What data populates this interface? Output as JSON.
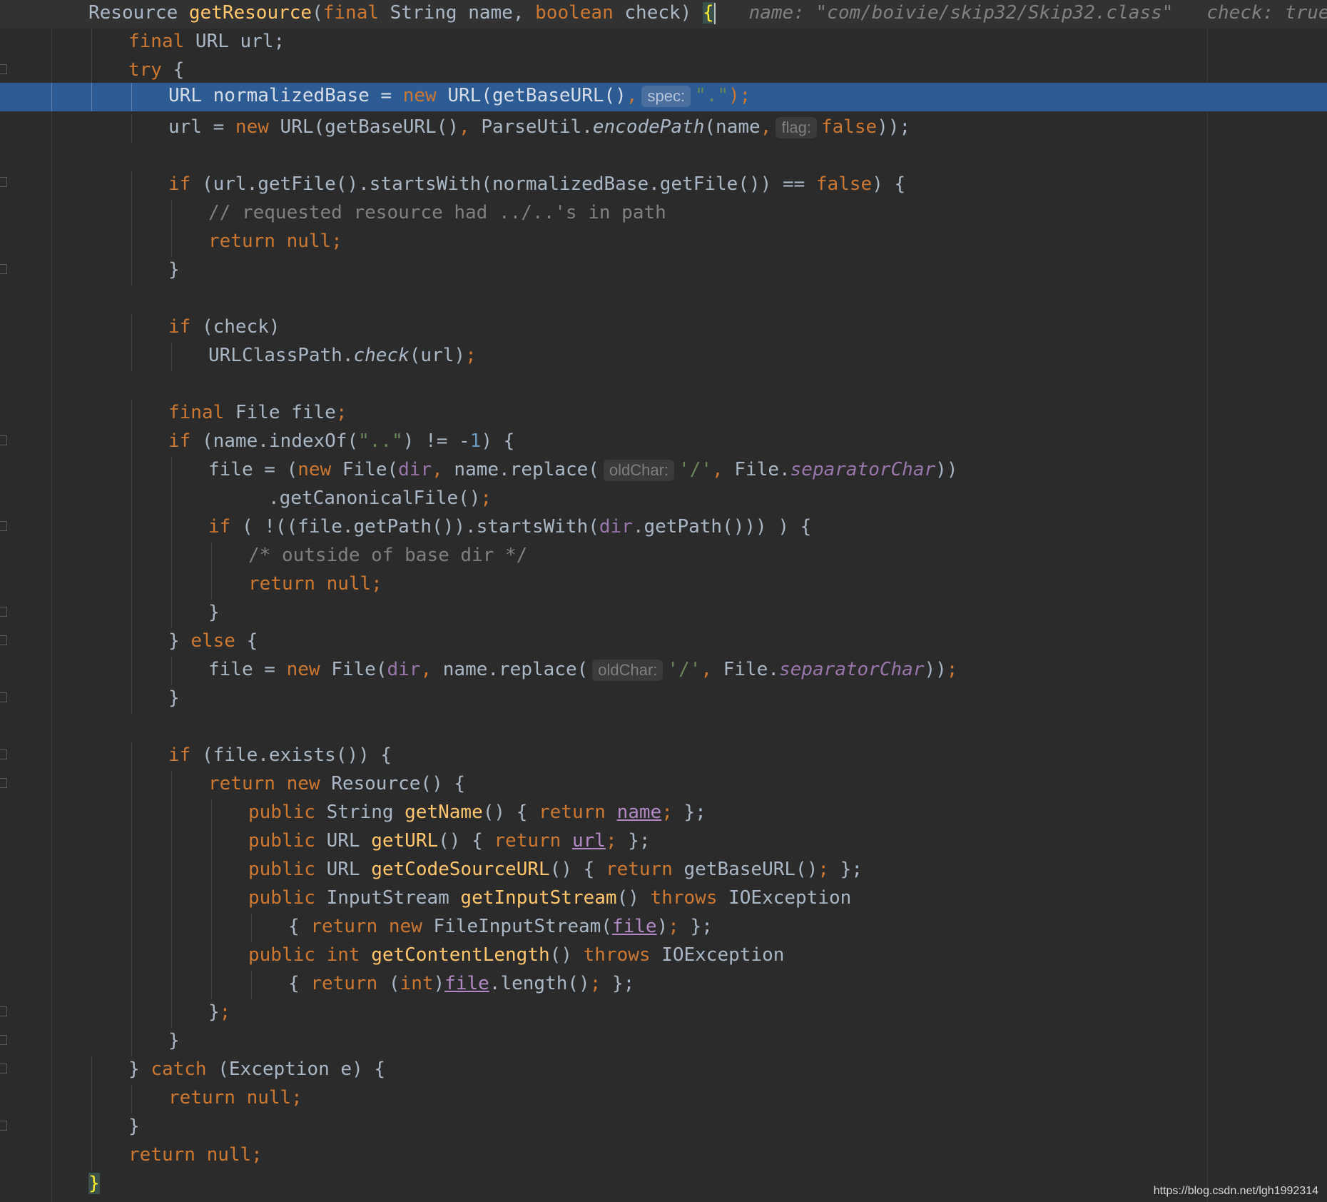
{
  "editor": {
    "theme_colors": {
      "background": "#2b2b2b",
      "keyword": "#cc7832",
      "method": "#ffc66d",
      "string": "#6a8759",
      "number": "#6897bb",
      "comment": "#808080",
      "field": "#9876aa",
      "execution_line": "#2d5b93"
    }
  },
  "lines": {
    "l1": {
      "a": "Resource ",
      "b": "getResource",
      "c": "(",
      "d": "final ",
      "e": "String name, ",
      "f": "boolean ",
      "g": "check) ",
      "h": "{",
      "i": "name: \"com/boivie/skip32/Skip32.class\"   check: true"
    },
    "l2": {
      "a": "final ",
      "b": "URL url;"
    },
    "l3": {
      "a": "try ",
      "b": "{"
    },
    "l4": {
      "a": "URL normalizedBase = ",
      "b": "new ",
      "c": "URL(getBaseURL()",
      "d": ",",
      "hint": "spec:",
      "e": "\".\"",
      "f": ");"
    },
    "l5": {
      "a": "url = ",
      "b": "new ",
      "c": "URL(getBaseURL()",
      "d": ", ",
      "e": "ParseUtil.",
      "f": "encodePath",
      "g": "(name",
      "h": ",",
      "hint": "flag:",
      "i": "false",
      "j": "));"
    },
    "l6": {
      "a": "if ",
      "b": "(url.getFile().startsWith(normalizedBase.getFile()) == ",
      "c": "false",
      "d": ") {"
    },
    "l7": {
      "a": "// requested resource had ../..'s in path"
    },
    "l8": {
      "a": "return null;"
    },
    "l9": {
      "a": "}"
    },
    "l10": {
      "a": "if ",
      "b": "(check)"
    },
    "l11": {
      "a": "URLClassPath.",
      "b": "check",
      "c": "(url)",
      "d": ";"
    },
    "l12": {
      "a": "final ",
      "b": "File file",
      "c": ";"
    },
    "l13": {
      "a": "if ",
      "b": "(name.indexOf(",
      "c": "\"..\"",
      "d": ") != -",
      "e": "1",
      "f": ") {"
    },
    "l14": {
      "a": "file = (",
      "b": "new ",
      "c": "File(",
      "d": "dir",
      "e": ", ",
      "f": "name.replace(",
      "hint": "oldChar:",
      "g": "'/'",
      "h": ", ",
      "i": "File.",
      "j": "separatorChar",
      "k": "))"
    },
    "l15": {
      "a": ".getCanonicalFile()",
      "b": ";"
    },
    "l16": {
      "a": "if ",
      "b": "( !((file.getPath()).startsWith(",
      "c": "dir",
      "d": ".getPath())) ) {"
    },
    "l17": {
      "a": "/* outside of base dir */"
    },
    "l18": {
      "a": "return null;"
    },
    "l19": {
      "a": "}"
    },
    "l20": {
      "a": "} ",
      "b": "else ",
      "c": "{"
    },
    "l21": {
      "a": "file = ",
      "b": "new ",
      "c": "File(",
      "d": "dir",
      "e": ", ",
      "f": "name.replace(",
      "hint": "oldChar:",
      "g": "'/'",
      "h": ", ",
      "i": "File.",
      "j": "separatorChar",
      "k": "))",
      "l": ";"
    },
    "l22": {
      "a": "}"
    },
    "l23": {
      "a": "if ",
      "b": "(file.exists()) {"
    },
    "l24": {
      "a": "return new ",
      "b": "Resource() {"
    },
    "l25": {
      "a": "public ",
      "b": "String ",
      "c": "getName",
      "d": "() { ",
      "e": "return ",
      "f": "name",
      "g": "; ",
      "h": "};"
    },
    "l26": {
      "a": "public ",
      "b": "URL ",
      "c": "getURL",
      "d": "() { ",
      "e": "return ",
      "f": "url",
      "g": "; ",
      "h": "};"
    },
    "l27": {
      "a": "public ",
      "b": "URL ",
      "c": "getCodeSourceURL",
      "d": "() { ",
      "e": "return ",
      "f": "getBaseURL()",
      "g": "; ",
      "h": "};"
    },
    "l28": {
      "a": "public ",
      "b": "InputStream ",
      "c": "getInputStream",
      "d": "() ",
      "e": "throws ",
      "f": "IOException"
    },
    "l29": {
      "a": "{ ",
      "b": "return new ",
      "c": "FileInputStream(",
      "d": "file",
      "e": ")",
      "f": "; ",
      "g": "};"
    },
    "l30": {
      "a": "public int ",
      "b": "getContentLength",
      "c": "() ",
      "d": "throws ",
      "e": "IOException"
    },
    "l31": {
      "a": "{ ",
      "b": "return ",
      "c": "(",
      "d": "int",
      "e": ")",
      "f": "file",
      "g": ".length()",
      "h": "; ",
      "i": "};"
    },
    "l32": {
      "a": "}",
      "b": ";"
    },
    "l33": {
      "a": "}"
    },
    "l34": {
      "a": "} ",
      "b": "catch ",
      "c": "(Exception e) {"
    },
    "l35": {
      "a": "return null;"
    },
    "l36": {
      "a": "}"
    },
    "l37": {
      "a": "return null;"
    },
    "l38": {
      "a": "}"
    }
  },
  "watermark": "https://blog.csdn.net/lgh1992314"
}
